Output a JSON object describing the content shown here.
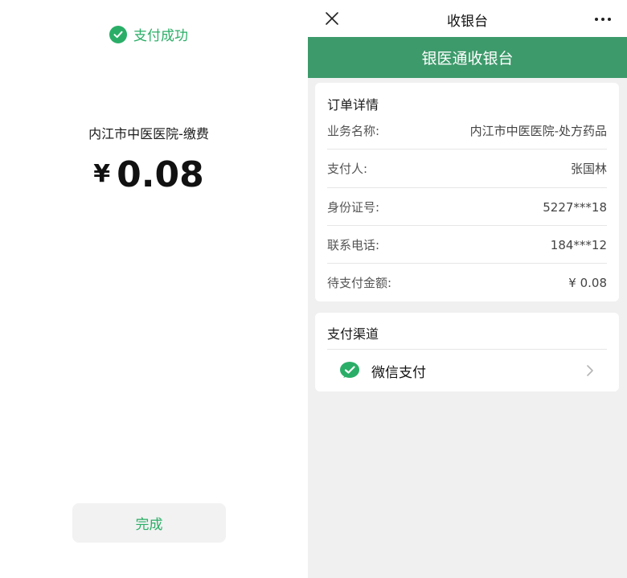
{
  "success": {
    "status_text": "支付成功",
    "merchant": "内江市中医医院-缴费",
    "currency_symbol": "¥",
    "amount": "0.08",
    "done_label": "完成"
  },
  "cashier": {
    "topbar_title": "收银台",
    "header_title": "银医通收银台",
    "order_title": "订单详情",
    "rows": [
      {
        "label": "业务名称:",
        "value": "内江市中医医院-处方药品"
      },
      {
        "label": "支付人:",
        "value": "张国林"
      },
      {
        "label": "身份证号:",
        "value": "5227***18"
      },
      {
        "label": "联系电话:",
        "value": "184***12"
      },
      {
        "label": "待支付金额:",
        "value": "¥ 0.08"
      }
    ],
    "channel_title": "支付渠道",
    "channel_label": "微信支付"
  },
  "colors": {
    "wechat_green": "#2aae67",
    "header_green": "#3d9a6b"
  },
  "icons": [
    "check-circle-icon",
    "close-icon",
    "more-dots-icon",
    "wechat-pay-icon",
    "chevron-right-icon"
  ]
}
